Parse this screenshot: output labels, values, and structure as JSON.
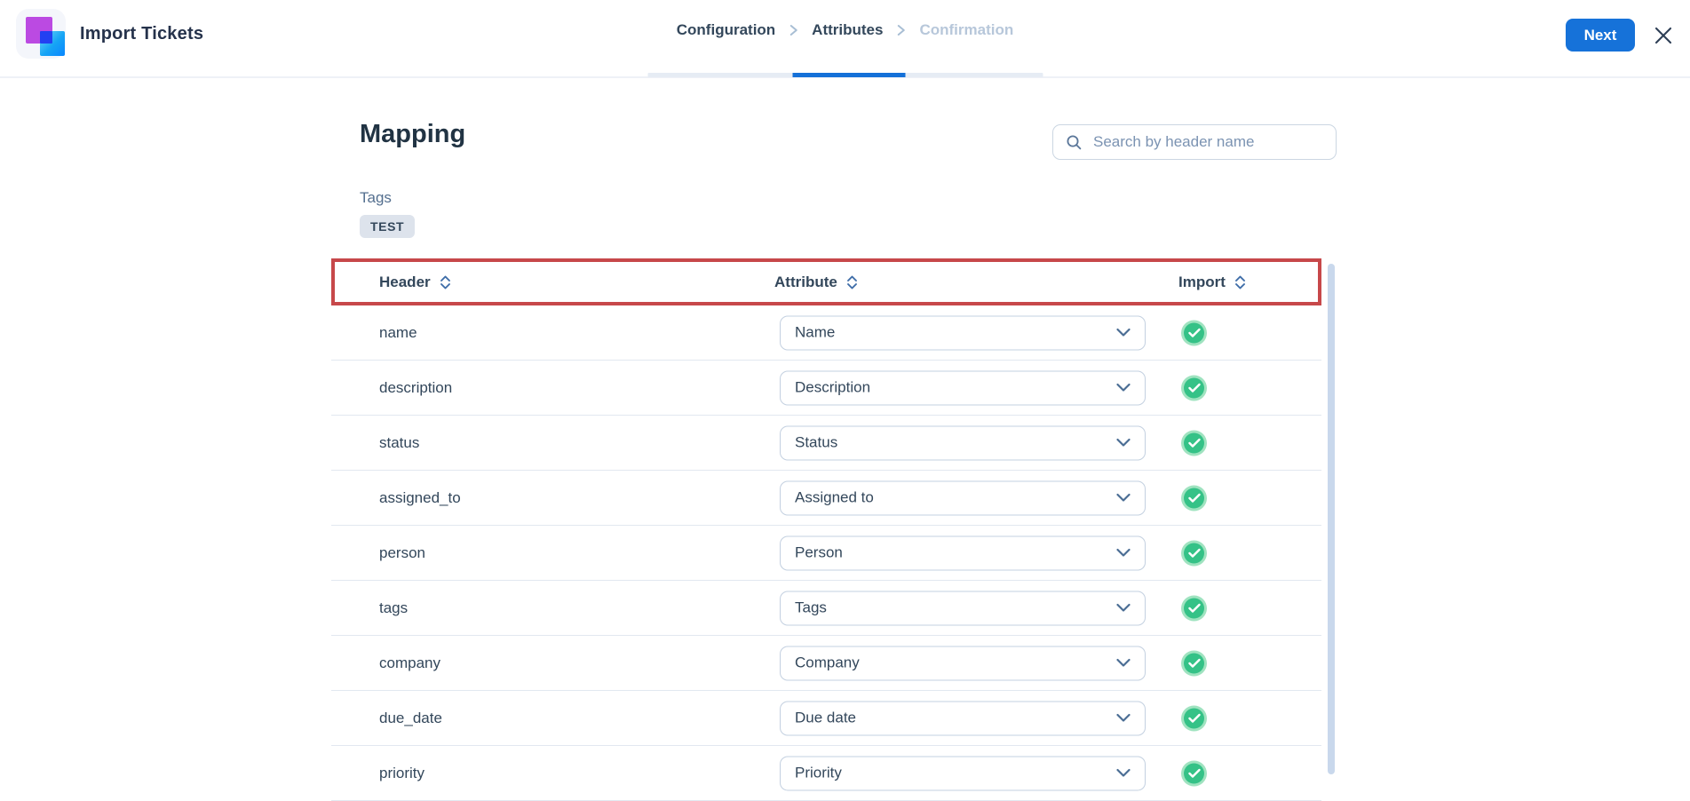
{
  "header": {
    "app_title": "Import Tickets",
    "breadcrumb": [
      {
        "label": "Configuration",
        "state": "done"
      },
      {
        "label": "Attributes",
        "state": "active"
      },
      {
        "label": "Confirmation",
        "state": "upcoming"
      }
    ],
    "next_button_label": "Next"
  },
  "main": {
    "title": "Mapping",
    "search_placeholder": "Search by header name",
    "tags_label": "Tags",
    "tag_badge": "TEST",
    "table": {
      "columns": [
        "Header",
        "Attribute",
        "Import"
      ],
      "rows": [
        {
          "header": "name",
          "attribute": "Name",
          "import": true
        },
        {
          "header": "description",
          "attribute": "Description",
          "import": true
        },
        {
          "header": "status",
          "attribute": "Status",
          "import": true
        },
        {
          "header": "assigned_to",
          "attribute": "Assigned to",
          "import": true
        },
        {
          "header": "person",
          "attribute": "Person",
          "import": true
        },
        {
          "header": "tags",
          "attribute": "Tags",
          "import": true
        },
        {
          "header": "company",
          "attribute": "Company",
          "import": true
        },
        {
          "header": "due_date",
          "attribute": "Due date",
          "import": true
        },
        {
          "header": "priority",
          "attribute": "Priority",
          "import": true
        }
      ]
    }
  },
  "colors": {
    "accent_blue": "#1672d9",
    "active_tab_blue": "#1470d8",
    "highlight_red": "#c7484a",
    "check_green": "#35c287",
    "check_green_light": "#a0e3c0",
    "text_dark": "#213343",
    "text_secondary": "#33475b",
    "inactive_crumb": "#b7c7da"
  }
}
